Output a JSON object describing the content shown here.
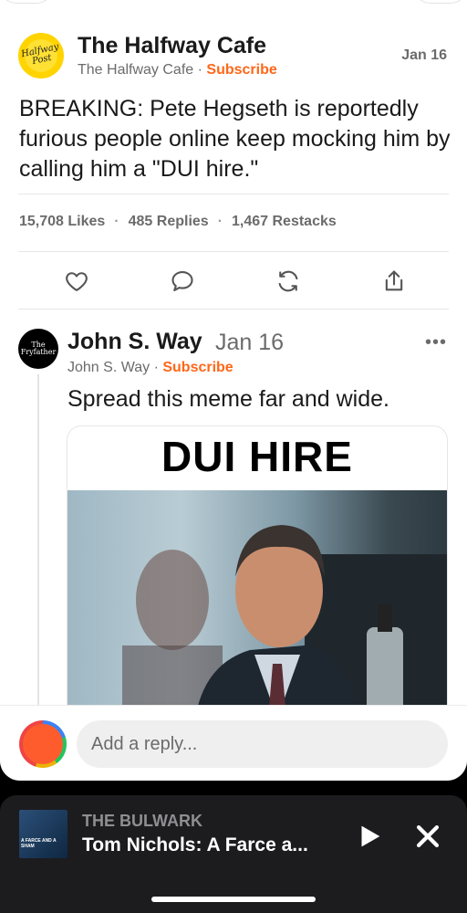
{
  "post": {
    "publication": "The Halfway Cafe",
    "logo_text": "Halfway Post",
    "byline": "The Halfway Cafe",
    "subscribe": "Subscribe",
    "date": "Jan 16",
    "body": "BREAKING: Pete Hegseth is reportedly furious people online keep mocking him by calling him a \"DUI hire.\"",
    "stats": {
      "likes": "15,708 Likes",
      "replies": "485 Replies",
      "restacks": "1,467 Restacks"
    }
  },
  "reply": {
    "author": "John S. Way",
    "avatar_text": "The Fryfather",
    "date": "Jan 16",
    "byline": "John S. Way",
    "subscribe": "Subscribe",
    "text": "Spread this meme far and wide.",
    "meme_title": "DUI HIRE"
  },
  "reply_bar": {
    "placeholder": "Add a reply..."
  },
  "player": {
    "show": "THE BULWARK",
    "episode": "Tom Nichols: A Farce a...",
    "art_text": "A FARCE AND A SHAM"
  },
  "colors": {
    "accent": "#ff6719",
    "text": "#1a1a1a",
    "muted": "#6b6b6b",
    "player_bg": "#1c1c1e"
  },
  "icons": {
    "like": "heart-icon",
    "reply": "comment-bubble-icon",
    "restack": "restack-icon",
    "share": "share-icon",
    "more": "more-dots-icon",
    "play": "play-icon",
    "close": "close-icon"
  }
}
